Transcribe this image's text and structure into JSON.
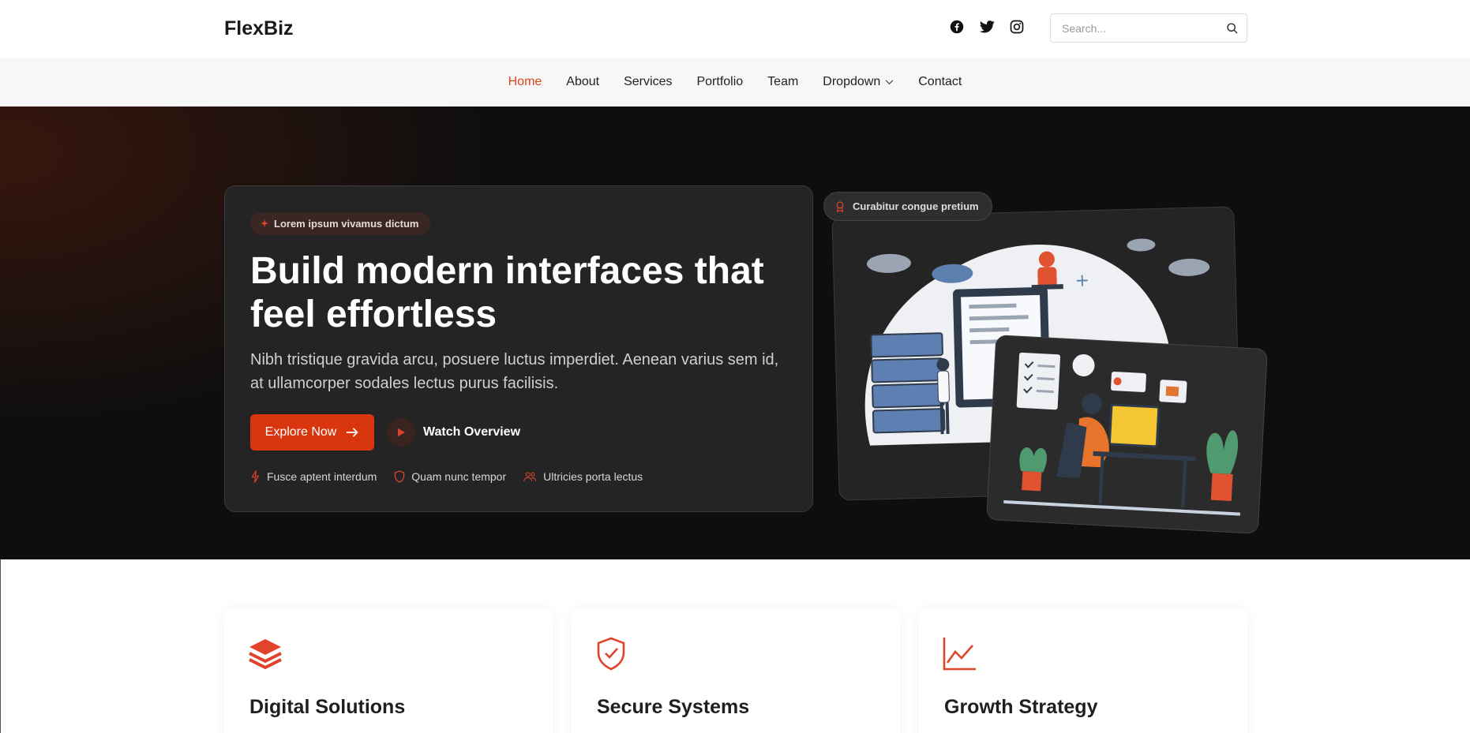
{
  "brand": {
    "name": "FlexBiz"
  },
  "socials": [
    {
      "icon": "facebook-icon"
    },
    {
      "icon": "twitter-icon"
    },
    {
      "icon": "instagram-icon"
    }
  ],
  "search": {
    "placeholder": "Search...",
    "value": ""
  },
  "nav": {
    "items": [
      {
        "label": "Home",
        "active": true
      },
      {
        "label": "About"
      },
      {
        "label": "Services"
      },
      {
        "label": "Portfolio"
      },
      {
        "label": "Team"
      },
      {
        "label": "Dropdown",
        "has_dropdown": true
      },
      {
        "label": "Contact"
      }
    ]
  },
  "hero": {
    "badge": "Lorem ipsum vivamus dictum",
    "title": "Build modern interfaces that feel effortless",
    "subtitle": "Nibh tristique gravida arcu, posuere luctus imperdiet. Aenean varius sem id, at ullamcorper sodales lectus purus facilisis.",
    "primary_button": "Explore Now",
    "secondary_button": "Watch Overview",
    "features": [
      {
        "icon": "bolt-icon",
        "label": "Fusce aptent interdum"
      },
      {
        "icon": "shield-icon",
        "label": "Quam nunc tempor"
      },
      {
        "icon": "users-icon",
        "label": "Ultricies porta lectus"
      }
    ],
    "illustration_tag": "Curabitur congue pretium"
  },
  "cards": [
    {
      "icon": "layers-icon",
      "title": "Digital Solutions"
    },
    {
      "icon": "shield-check-icon",
      "title": "Secure Systems"
    },
    {
      "icon": "chart-line-icon",
      "title": "Growth Strategy"
    }
  ],
  "colors": {
    "accent": "#d9451f",
    "button": "#d9360f",
    "hero_bg": "#0e0e0e",
    "hero_card": "#242424"
  }
}
